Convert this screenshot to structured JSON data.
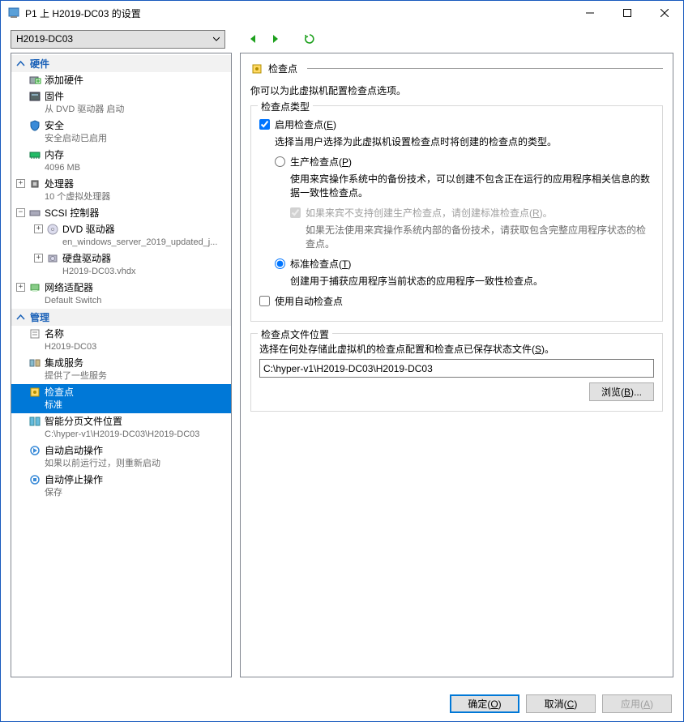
{
  "window": {
    "title": "P1 上 H2019-DC03 的设置"
  },
  "toolbar": {
    "selected_vm": "H2019-DC03"
  },
  "sidebar": {
    "hardware_header": "硬件",
    "add_hw": {
      "label": "添加硬件"
    },
    "firmware": {
      "label": "固件",
      "sub": "从 DVD 驱动器 启动"
    },
    "security": {
      "label": "安全",
      "sub": "安全启动已启用"
    },
    "memory": {
      "label": "内存",
      "sub": "4096 MB"
    },
    "processor": {
      "label": "处理器",
      "sub": "10 个虚拟处理器"
    },
    "scsi": {
      "label": "SCSI 控制器"
    },
    "dvd": {
      "label": "DVD 驱动器",
      "sub": "en_windows_server_2019_updated_j..."
    },
    "hdd": {
      "label": "硬盘驱动器",
      "sub": "H2019-DC03.vhdx"
    },
    "netadapter": {
      "label": "网络适配器",
      "sub": "Default Switch"
    },
    "management_header": "管理",
    "name": {
      "label": "名称",
      "sub": "H2019-DC03"
    },
    "integration": {
      "label": "集成服务",
      "sub": "提供了一些服务"
    },
    "checkpoints": {
      "label": "检查点",
      "sub": "标准"
    },
    "paging": {
      "label": "智能分页文件位置",
      "sub": "C:\\hyper-v1\\H2019-DC03\\H2019-DC03"
    },
    "autostart": {
      "label": "自动启动操作",
      "sub": "如果以前运行过，则重新启动"
    },
    "autostop": {
      "label": "自动停止操作",
      "sub": "保存"
    }
  },
  "pane": {
    "title": "检查点",
    "intro": "你可以为此虚拟机配置检查点选项。",
    "group_type": "检查点类型",
    "enable_label": "启用检查点(E)",
    "enable_desc": "选择当用户选择为此虚拟机设置检查点时将创建的检查点的类型。",
    "prod_label": "生产检查点(P)",
    "prod_desc": "使用来宾操作系统中的备份技术，可以创建不包含正在运行的应用程序相关信息的数据一致性检查点。",
    "prod_fallback_label": "如果来宾不支持创建生产检查点，请创建标准检查点(R)。",
    "prod_fallback_desc": "如果无法使用来宾操作系统内部的备份技术，请获取包含完整应用程序状态的检查点。",
    "std_label": "标准检查点(T)",
    "std_desc": "创建用于捕获应用程序当前状态的应用程序一致性检查点。",
    "auto_label": "使用自动检查点",
    "group_loc": "检查点文件位置",
    "loc_desc": "选择在何处存储此虚拟机的检查点配置和检查点已保存状态文件(S)。",
    "loc_path": "C:\\hyper-v1\\H2019-DC03\\H2019-DC03",
    "browse": "浏览(B)..."
  },
  "footer": {
    "ok": "确定(O)",
    "cancel": "取消(C)",
    "apply": "应用(A)"
  }
}
